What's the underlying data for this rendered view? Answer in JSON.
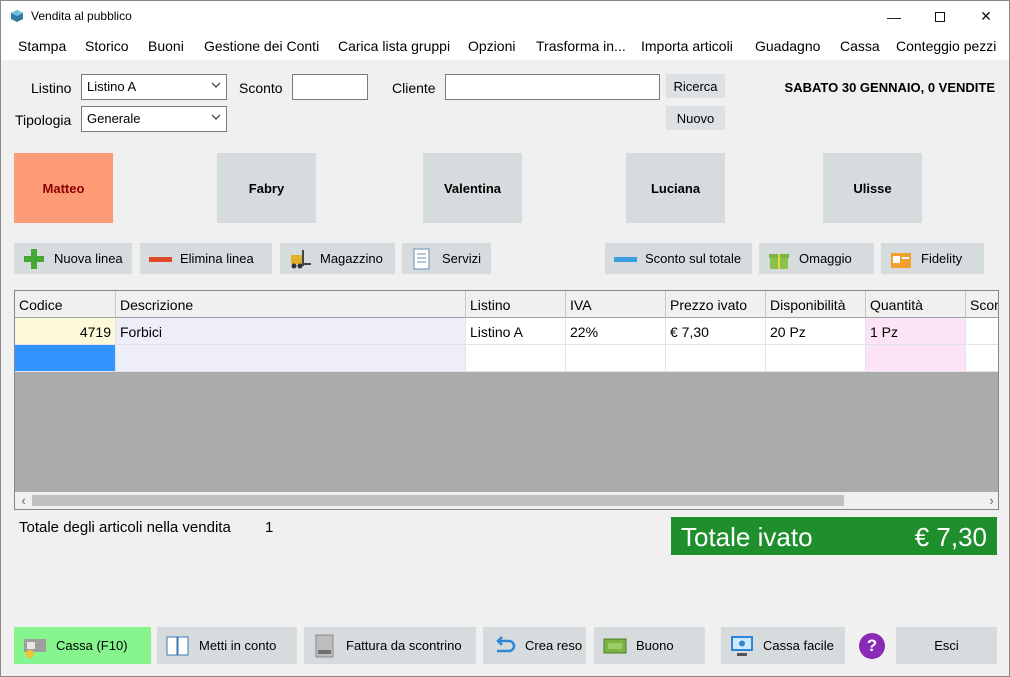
{
  "window": {
    "title": "Vendita al pubblico",
    "min_glyph": "—",
    "close_glyph": "✕"
  },
  "menu": [
    "Stampa",
    "Storico",
    "Buoni",
    "Gestione dei Conti",
    "Carica lista gruppi",
    "Opzioni",
    "Trasforma in...",
    "Importa articoli",
    "Guadagno",
    "Cassa",
    "Conteggio pezzi"
  ],
  "form": {
    "listino_label": "Listino",
    "listino_value": "Listino A",
    "sconto_label": "Sconto",
    "sconto_value": "",
    "cliente_label": "Cliente",
    "cliente_value": "",
    "tipologia_label": "Tipologia",
    "tipologia_value": "Generale",
    "ricerca_label": "Ricerca",
    "nuovo_label": "Nuovo",
    "date_status": "SABATO 30 GENNAIO, 0 VENDITE"
  },
  "operators": [
    {
      "name": "Matteo",
      "active": true
    },
    {
      "name": "Fabry",
      "active": false
    },
    {
      "name": "Valentina",
      "active": false
    },
    {
      "name": "Luciana",
      "active": false
    },
    {
      "name": "Ulisse",
      "active": false
    }
  ],
  "toolbar": {
    "nuova_linea": "Nuova linea",
    "elimina_linea": "Elimina linea",
    "magazzino": "Magazzino",
    "servizi": "Servizi",
    "sconto_totale": "Sconto sul totale",
    "omaggio": "Omaggio",
    "fidelity": "Fidelity"
  },
  "table": {
    "headers": [
      "Codice",
      "Descrizione",
      "Listino",
      "IVA",
      "Prezzo ivato",
      "Disponibilità",
      "Quantità",
      "Scon"
    ],
    "rows": [
      [
        "4719",
        "Forbici",
        "Listino A",
        "22%",
        "€ 7,30",
        "20 Pz",
        "1 Pz",
        ""
      ]
    ],
    "scroll_left": "‹",
    "scroll_right": "›"
  },
  "totals": {
    "items_label": "Totale degli articoli nella vendita",
    "items_count": "1",
    "total_label": "Totale ivato",
    "total_value": "€ 7,30"
  },
  "bottom": {
    "cassa": "Cassa (F10)",
    "metti_conto": "Metti in conto",
    "fattura": "Fattura da scontrino",
    "crea_reso": "Crea reso",
    "buono": "Buono",
    "cassa_facile": "Cassa facile",
    "help": "?",
    "esci": "Esci"
  },
  "colors": {
    "operator_active": "#fe9b77",
    "total_bg": "#1f8f2e",
    "cassa_btn": "#86f58d",
    "selection": "#3394ff"
  }
}
